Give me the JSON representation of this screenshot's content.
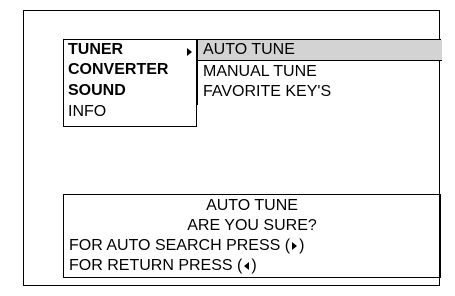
{
  "menu": {
    "items": [
      {
        "label": "TUNER",
        "selected": true
      },
      {
        "label": "CONVERTER"
      },
      {
        "label": "SOUND"
      },
      {
        "label": "INFO"
      }
    ]
  },
  "submenu": {
    "items": [
      {
        "label": "AUTO TUNE",
        "highlighted": true
      },
      {
        "label": "MANUAL TUNE"
      },
      {
        "label": "FAVORITE KEY'S"
      }
    ],
    "highlight_color": "#d3d3d3"
  },
  "dialog": {
    "title": "AUTO TUNE",
    "question": "ARE YOU SURE?",
    "search_prefix": "FOR AUTO SEARCH PRESS (",
    "search_icon": "triangle-right-icon",
    "search_suffix": ")",
    "return_prefix": "FOR RETURN PRESS (",
    "return_icon": "triangle-left-icon",
    "return_suffix": ")"
  }
}
